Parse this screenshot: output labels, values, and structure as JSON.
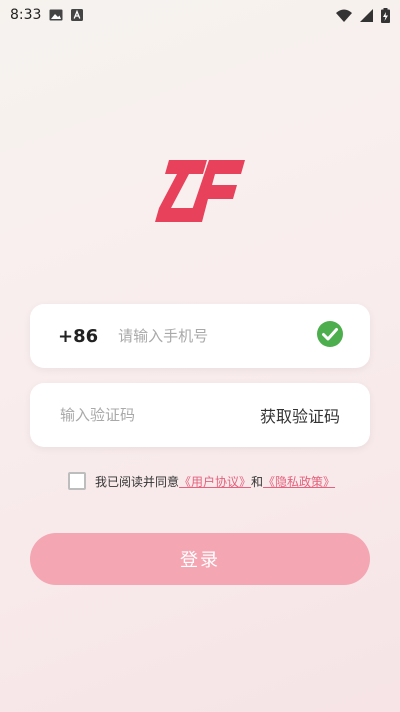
{
  "status_bar": {
    "time": "8:33",
    "icons": [
      "image-icon",
      "a-notification-icon",
      "wifi-icon",
      "signal-icon",
      "battery-charging-icon"
    ]
  },
  "brand": {
    "logo": "ZF",
    "logo_color": "#e8415b"
  },
  "phone": {
    "country_code": "+86",
    "value": "",
    "placeholder": "请输入手机号",
    "valid_icon": "check-circle-icon",
    "valid_color": "#4cae4c"
  },
  "verification": {
    "value": "",
    "placeholder": "输入验证码",
    "get_code_label": "获取验证码"
  },
  "agreement": {
    "checked": false,
    "prefix": "我已阅读并同意",
    "user_agreement": "《用户协议》",
    "and": "和",
    "privacy_policy": "《隐私政策》",
    "link_color": "#e4627d"
  },
  "login": {
    "label": "登录",
    "color": "#f4a6b3"
  }
}
